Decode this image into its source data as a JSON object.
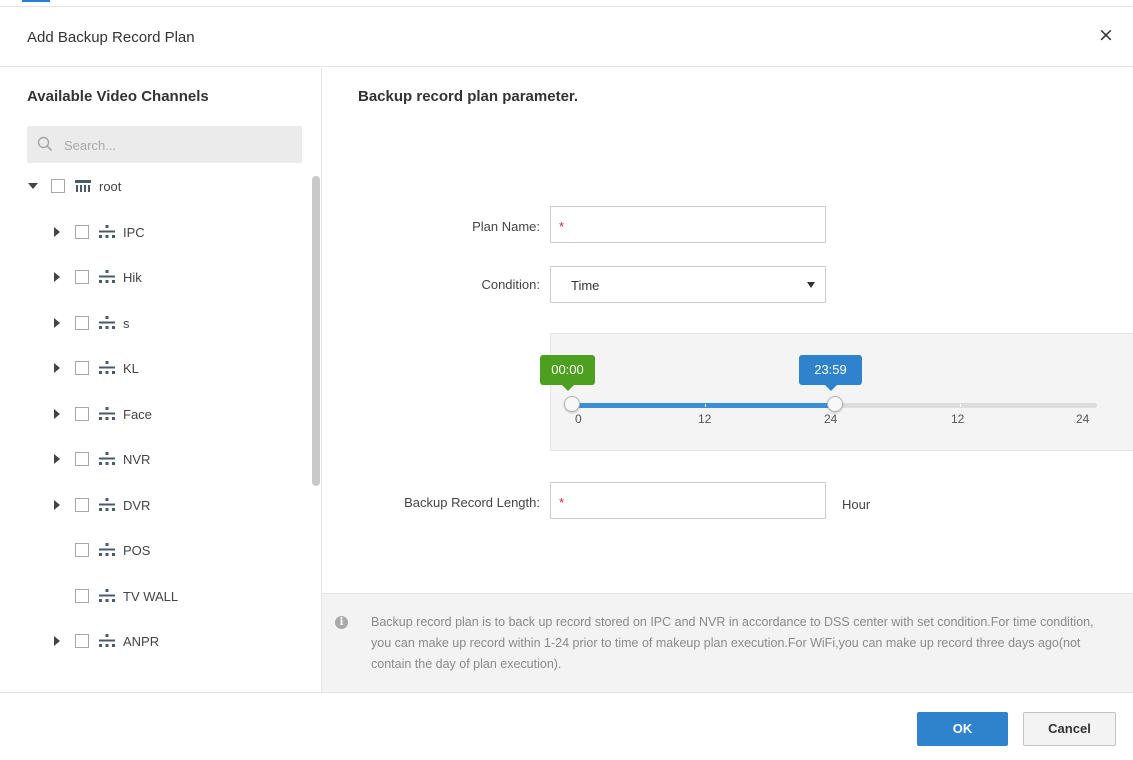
{
  "dialog": {
    "title": "Add Backup Record Plan",
    "close_label": "×"
  },
  "channels": {
    "heading": "Available Video Channels",
    "search_placeholder": "Search...",
    "tree": [
      {
        "label": "root",
        "expandable": true,
        "expanded": true,
        "checked": false,
        "icon": "org-root-icon"
      },
      {
        "label": "IPC",
        "expandable": true,
        "expanded": false,
        "checked": false,
        "icon": "org-node-icon"
      },
      {
        "label": "Hik",
        "expandable": true,
        "expanded": false,
        "checked": false,
        "icon": "org-node-icon"
      },
      {
        "label": "s",
        "expandable": true,
        "expanded": false,
        "checked": false,
        "icon": "org-node-icon"
      },
      {
        "label": "KL",
        "expandable": true,
        "expanded": false,
        "checked": false,
        "icon": "org-node-icon"
      },
      {
        "label": "Face",
        "expandable": true,
        "expanded": false,
        "checked": false,
        "icon": "org-node-icon"
      },
      {
        "label": "NVR",
        "expandable": true,
        "expanded": false,
        "checked": false,
        "icon": "org-node-icon"
      },
      {
        "label": "DVR",
        "expandable": true,
        "expanded": false,
        "checked": false,
        "icon": "org-node-icon"
      },
      {
        "label": "POS",
        "expandable": false,
        "expanded": false,
        "checked": false,
        "icon": "org-node-icon"
      },
      {
        "label": "TV WALL",
        "expandable": false,
        "expanded": false,
        "checked": false,
        "icon": "org-node-icon"
      },
      {
        "label": "ANPR",
        "expandable": true,
        "expanded": false,
        "checked": false,
        "icon": "org-node-icon"
      }
    ]
  },
  "form": {
    "heading": "Backup record plan parameter.",
    "plan_name_label": "Plan Name:",
    "plan_name_value": "",
    "required_mark": "*",
    "condition_label": "Condition:",
    "condition_value": "Time",
    "time_range": {
      "start_label": "00:00",
      "end_label": "23:59",
      "start_fraction": 0,
      "end_fraction": 0.5,
      "ticks": [
        "0",
        "12",
        "24",
        "12",
        "24"
      ]
    },
    "length_label": "Backup Record Length:",
    "length_value": "",
    "length_unit": "Hour"
  },
  "info": {
    "text": "Backup record plan is to back up record stored on IPC and NVR in accordance to DSS center with set condition.For time condition, you can make up record within 1-24 prior to time of makeup plan execution.For WiFi,you can make up record three days ago(not contain the day of plan execution)."
  },
  "footer": {
    "ok_label": "OK",
    "cancel_label": "Cancel"
  },
  "colors": {
    "primary": "#2f83cc",
    "start_tag": "#4c9f1f",
    "required": "#e23333"
  }
}
